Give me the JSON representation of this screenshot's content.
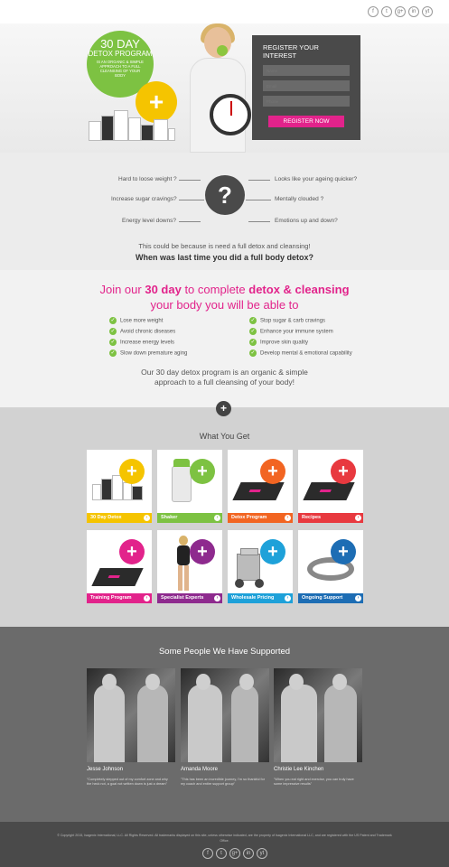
{
  "social": [
    "f",
    "t",
    "g+",
    "in",
    "yt"
  ],
  "hero": {
    "circle_title": "30 DAY",
    "circle_sub": "DETOX PROGRAM",
    "circle_desc": "IS AN ORGANIC & SIMPLE APPROACH TO A FULL CLEANSING OF YOUR BODY",
    "form_title": "REGISTER YOUR INTEREST",
    "name_placeholder": "Name",
    "email_placeholder": "Email",
    "phone_placeholder": "Phone",
    "button": "REGISTER NOW"
  },
  "questions": {
    "left": [
      "Hard to loose weight ?",
      "Increase sugar cravings?",
      "Energy level downs?"
    ],
    "right": [
      "Looks like your ageing quicker?",
      "Mentally clouded ?",
      "Emotions up and down?"
    ],
    "center": "?",
    "small": "This could be because is need a full detox and cleansing!",
    "big": "When was last time you did a full body detox?"
  },
  "join": {
    "line1_a": "Join our ",
    "line1_b": "30 day",
    "line1_c": " to complete ",
    "line1_d": "detox & cleansing",
    "line2": "your body you will be able to",
    "benefits_left": [
      "Lose more weight",
      "Avoid chronic diseases",
      "Increase energy levels",
      "Slow down premature aging"
    ],
    "benefits_right": [
      "Stop sugar & carb cravings",
      "Enhance your immune system",
      "Improve skin quality",
      "Develop mental & emotional capability"
    ],
    "p1": "Our 30 day detox program is an organic & simple",
    "p2": "approach to a full cleansing of your body!"
  },
  "wyg": {
    "title": "What You Get",
    "cards": [
      {
        "label": "30 Day Detox",
        "color": "#f5c400"
      },
      {
        "label": "Shaker",
        "color": "#7dc242"
      },
      {
        "label": "Detox Program",
        "color": "#f26522"
      },
      {
        "label": "Recipes",
        "color": "#e8393f"
      },
      {
        "label": "Training Program",
        "color": "#e2238b"
      },
      {
        "label": "Specialist Experts",
        "color": "#8e2a8e"
      },
      {
        "label": "Wholesale Pricing",
        "color": "#1ea1d9"
      },
      {
        "label": "Ongoing Support",
        "color": "#1d6db4"
      }
    ]
  },
  "testimonials": {
    "title": "Some People We Have Supported",
    "people": [
      {
        "name": "Jesse Johnson",
        "quote": "\"Completely stepped out of my comfort zone and why the heck not, a goal not written down is just a dream\""
      },
      {
        "name": "Amanda Moore",
        "quote": "\"This has been an incredible journey, I'm so thankful for my coach and entire support group\""
      },
      {
        "name": "Christie Lee Kinchen",
        "quote": "\"When you eat right and exercise, you can truly have some impressive results\""
      }
    ]
  },
  "footer": {
    "copyright": "© Copyright 2015, Isagenix International, LLC. All Rights Reserved. All trademarks displayed on this site, unless otherwise indicated, are the property of Isagenix International LLC, and are registered with the US Patent and Trademark Office."
  }
}
